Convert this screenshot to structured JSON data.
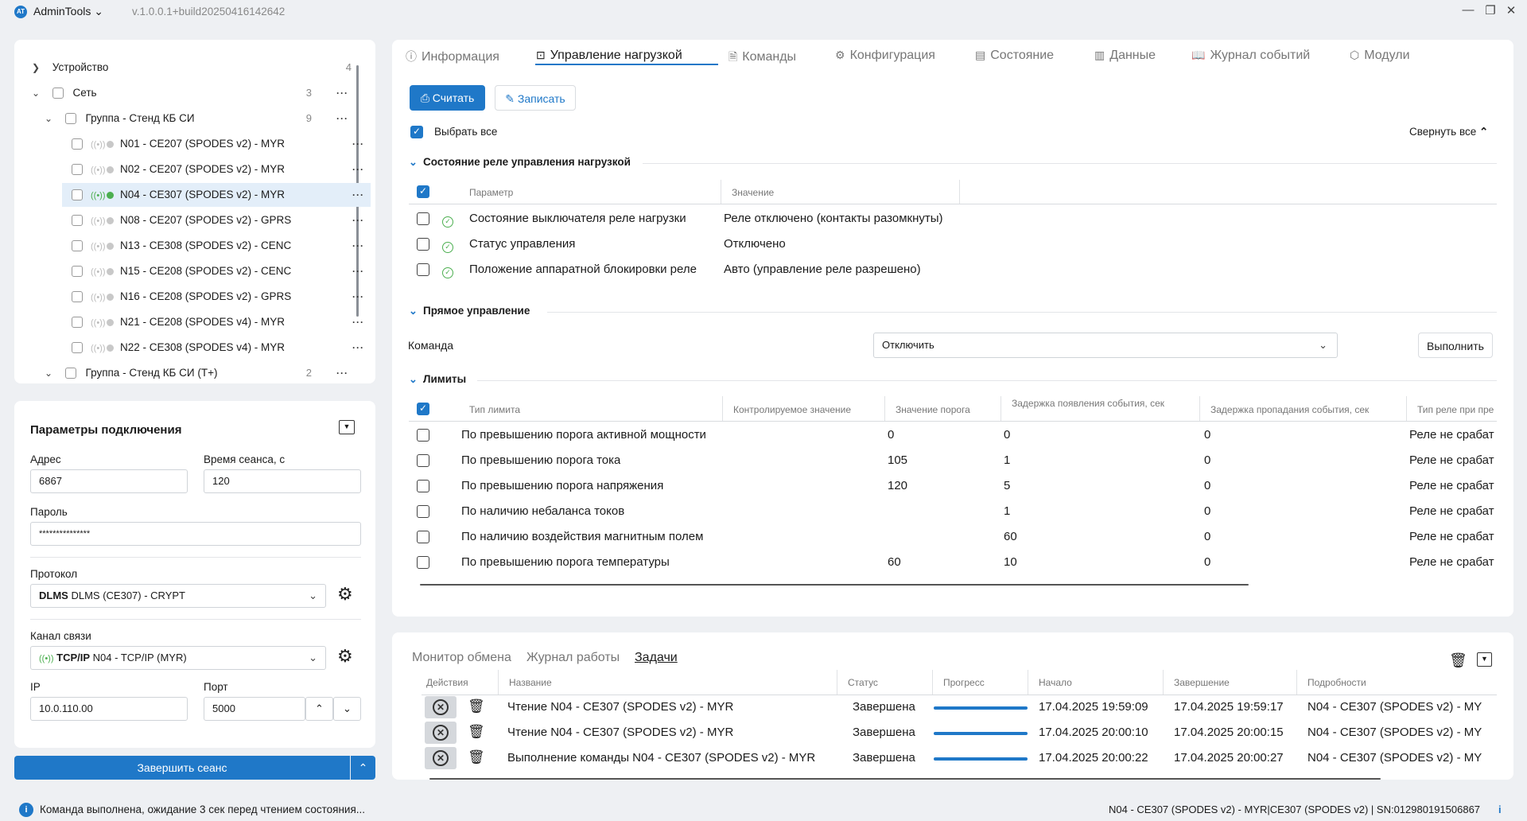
{
  "app": {
    "logo": "AT",
    "title": "AdminTools",
    "title_arrow": "⌄",
    "version": "v.1.0.0.1+build20250416142642"
  },
  "window": {
    "minimize": "—",
    "maximize": "❐",
    "close": "✕"
  },
  "tree": {
    "root": {
      "label": "Устройство",
      "count": "4"
    },
    "net": {
      "label": "Сеть",
      "count": "3"
    },
    "group1": {
      "label": "Группа - Стенд КБ СИ",
      "count": "9"
    },
    "devices": [
      {
        "label": "N01 - CE207 (SPODES v2) - MYR",
        "active": false
      },
      {
        "label": "N02 - CE207 (SPODES v2) - MYR",
        "active": false
      },
      {
        "label": "N04 - CE307 (SPODES v2) - MYR",
        "active": true
      },
      {
        "label": "N08 - CE207 (SPODES v2) - GPRS",
        "active": false
      },
      {
        "label": "N13 - CE308 (SPODES v2) - CENC",
        "active": false
      },
      {
        "label": "N15 - CE208 (SPODES v2) - CENC",
        "active": false
      },
      {
        "label": "N16 - CE208 (SPODES v2) - GPRS",
        "active": false
      },
      {
        "label": "N21 - CE208 (SPODES v4) - MYR",
        "active": false
      },
      {
        "label": "N22 - CE308 (SPODES v4) - MYR",
        "active": false
      }
    ],
    "group2": {
      "label": "Группа - Стенд КБ СИ (Т+)",
      "count": "2"
    }
  },
  "conn": {
    "title": "Параметры подключения",
    "addr_label": "Адрес",
    "addr": "6867",
    "time_label": "Время сеанса, с",
    "time": "120",
    "pass_label": "Пароль",
    "pass": "***************",
    "proto_label": "Протокол",
    "proto_bold": "DLMS",
    "proto": "DLMS (CE307) - CRYPT",
    "chan_label": "Канал связи",
    "chan_bold": "TCP/IP",
    "chan": "N04 - TCP/IP (MYR)",
    "ip_label": "IP",
    "ip": "10.0.110.00",
    "port_label": "Порт",
    "port": "5000",
    "end_btn": "Завершить сеанс"
  },
  "tabs": [
    {
      "icon": "ⓘ",
      "label": "Информация"
    },
    {
      "icon": "⊡",
      "label": "Управление нагрузкой"
    },
    {
      "icon": "🗎",
      "label": "Команды"
    },
    {
      "icon": "⚙",
      "label": "Конфигурация"
    },
    {
      "icon": "▤",
      "label": "Состояние"
    },
    {
      "icon": "▥",
      "label": "Данные"
    },
    {
      "icon": "📖",
      "label": "Журнал событий"
    },
    {
      "icon": "⬡",
      "label": "Модули"
    }
  ],
  "toolbar": {
    "read": "Считать",
    "write": "Записать",
    "select_all": "Выбрать все",
    "collapse_all": "Свернуть все"
  },
  "relay": {
    "title": "Состояние реле управления нагрузкой",
    "headers": [
      "Параметр",
      "Значение"
    ],
    "rows": [
      [
        "Состояние выключателя реле нагрузки",
        "Реле отключено (контакты разомкнуты)"
      ],
      [
        "Статус управления",
        "Отключено"
      ],
      [
        "Положение аппаратной блокировки реле",
        "Авто (управление реле разрешено)"
      ]
    ]
  },
  "direct": {
    "title": "Прямое управление",
    "cmd_label": "Команда",
    "cmd_value": "Отключить",
    "exec": "Выполнить"
  },
  "limits": {
    "title": "Лимиты",
    "headers": [
      "Тип лимита",
      "Контролируемое значение",
      "Значение порога",
      "Задержка появления события, сек",
      "Задержка пропадания события, сек",
      "Тип реле при пре"
    ],
    "rows": [
      [
        "По превышению порога активной мощности",
        "",
        "0",
        "0",
        "0",
        "Реле не срабат"
      ],
      [
        "По превышению порога тока",
        "",
        "105",
        "1",
        "0",
        "Реле не срабат"
      ],
      [
        "По превышению порога напряжения",
        "",
        "120",
        "5",
        "0",
        "Реле не срабат"
      ],
      [
        "По наличию небаланса токов",
        "",
        "",
        "1",
        "0",
        "Реле не срабат"
      ],
      [
        "По наличию воздействия магнитным полем",
        "",
        "",
        "60",
        "0",
        "Реле не срабат"
      ],
      [
        "По превышению порога температуры",
        "",
        "60",
        "10",
        "0",
        "Реле не срабат"
      ]
    ]
  },
  "bottom": {
    "tabs": [
      "Монитор обмена",
      "Журнал работы",
      "Задачи"
    ],
    "headers": [
      "Действия",
      "Название",
      "Статус",
      "Прогресс",
      "Начало",
      "Завершение",
      "Подробности"
    ],
    "rows": [
      {
        "name": "Чтение N04 - CE307 (SPODES v2) - MYR",
        "status": "Завершена",
        "progress": 100,
        "start": "17.04.2025 19:59:09",
        "end": "17.04.2025 19:59:17",
        "details": "N04 - CE307 (SPODES v2) - MY"
      },
      {
        "name": "Чтение N04 - CE307 (SPODES v2) - MYR",
        "status": "Завершена",
        "progress": 100,
        "start": "17.04.2025 20:00:10",
        "end": "17.04.2025 20:00:15",
        "details": "N04 - CE307 (SPODES v2) - MY"
      },
      {
        "name": "Выполнение команды N04 - CE307 (SPODES v2) - MYR",
        "status": "Завершена",
        "progress": 100,
        "start": "17.04.2025 20:00:22",
        "end": "17.04.2025 20:00:27",
        "details": "N04 - CE307 (SPODES v2) - MY"
      }
    ]
  },
  "status": {
    "message": "Команда выполнена, ожидание 3 сек перед чтением состояния...",
    "right": "N04 - CE307 (SPODES v2) - MYR|CE307 (SPODES v2) | SN:012980191506867",
    "info": "i"
  },
  "colors": {
    "accent": "#1f78c8",
    "online": "#4caf50"
  }
}
